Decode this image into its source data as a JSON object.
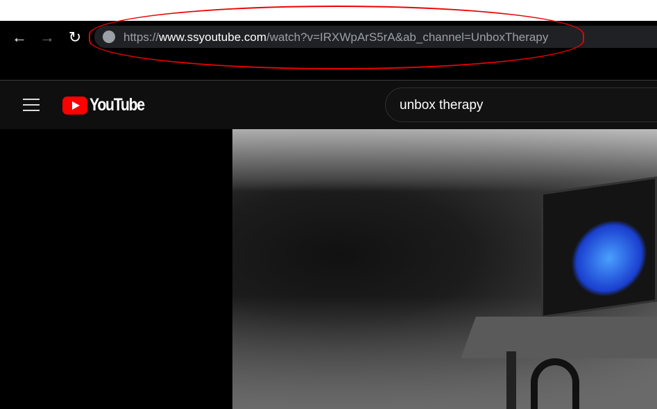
{
  "browser": {
    "url_scheme": "https://",
    "url_host": "www.ssyoutube.com",
    "url_path": "/watch?v=IRXWpArS5rA&ab_channel=UnboxTherapy",
    "back_icon": "←",
    "forward_icon": "→",
    "reload_icon": "↻"
  },
  "youtube": {
    "logo_text": "YouTube",
    "search_value": "unbox therapy",
    "brand_color": "#ff0000"
  },
  "annotation": {
    "color": "#e00000"
  }
}
